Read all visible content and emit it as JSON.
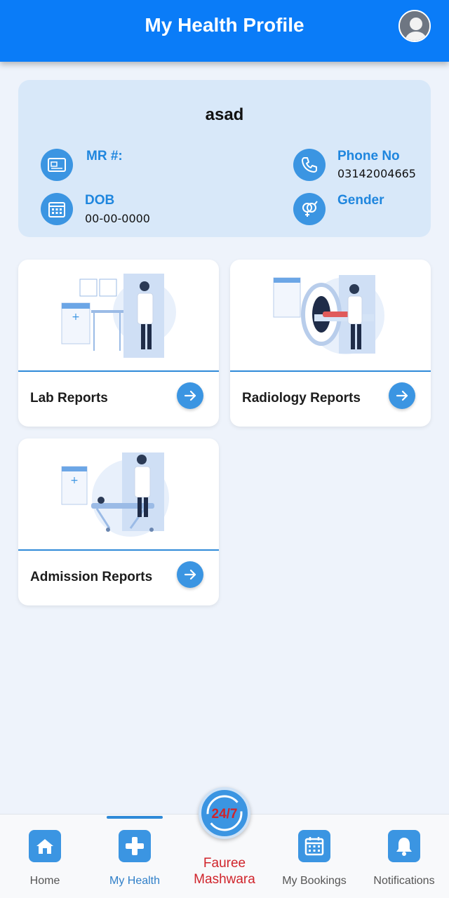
{
  "appbar": {
    "title": "My Health Profile"
  },
  "profile": {
    "name": "asad",
    "mr_label": "MR #:",
    "mr_value": "",
    "phone_label": "Phone No",
    "phone_value": "03142004665",
    "dob_label": "DOB",
    "dob_value": "00-00-0000",
    "gender_label": "Gender",
    "gender_value": ""
  },
  "reports": [
    {
      "label": "Lab Reports"
    },
    {
      "label": "Radiology Reports"
    },
    {
      "label": "Admission Reports"
    }
  ],
  "bottom_nav": {
    "items": [
      {
        "label": "Home",
        "icon": "home-icon"
      },
      {
        "label": "My Health",
        "icon": "plus-icon"
      },
      {
        "label": "My Bookings",
        "icon": "calendar-icon"
      },
      {
        "label": "Notifications",
        "icon": "bell-icon"
      }
    ],
    "center": {
      "line1": "Fauree",
      "line2": "Mashwara",
      "badge": "24/7"
    },
    "active": "My Health"
  },
  "colors": {
    "primary": "#0a7cf8",
    "accent": "#3b95e2",
    "card_bg": "#d8e8f9",
    "center_label": "#d0242b"
  }
}
